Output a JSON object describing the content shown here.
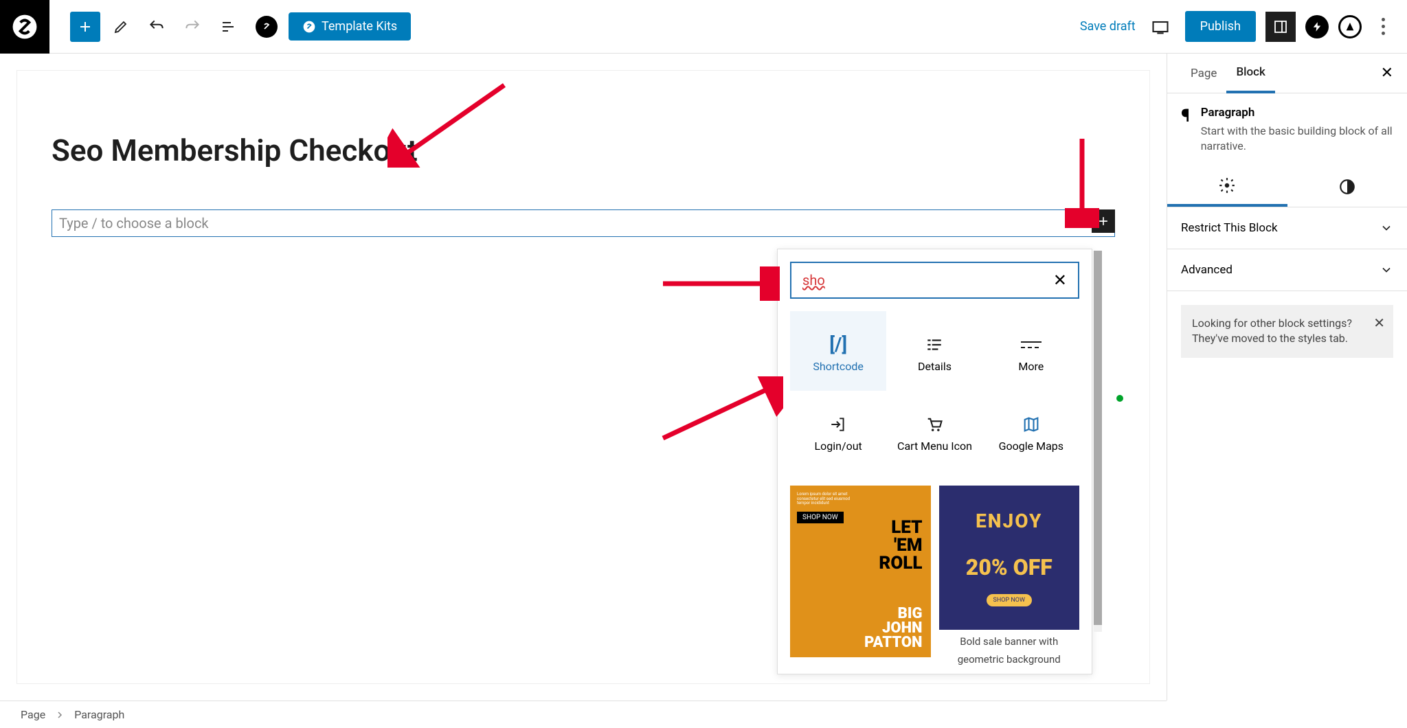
{
  "toolbar": {
    "template_kits": "Template Kits",
    "save_draft": "Save draft",
    "publish": "Publish"
  },
  "page": {
    "title": "Seo Membership Checkout",
    "block_placeholder": "Type / to choose a block"
  },
  "picker": {
    "search_value": "sho",
    "items": [
      {
        "label": "Shortcode"
      },
      {
        "label": "Details"
      },
      {
        "label": "More"
      },
      {
        "label": "Login/out"
      },
      {
        "label": "Cart Menu Icon"
      },
      {
        "label": "Google Maps"
      }
    ],
    "pattern1": {
      "line1": "LET",
      "line2": "'EM",
      "line3": "ROLL",
      "b1": "BIG",
      "b2": "JOHN",
      "b3": "PATTON",
      "shop": "SHOP NOW"
    },
    "pattern2": {
      "enjoy": "ENJOY",
      "percent": "20% OFF",
      "shop": "SHOP NOW",
      "caption1": "Bold sale banner with",
      "caption2": "geometric background"
    }
  },
  "sidebar": {
    "tabs": {
      "page": "Page",
      "block": "Block"
    },
    "block_name": "Paragraph",
    "block_desc": "Start with the basic building block of all narrative.",
    "panels": {
      "restrict": "Restrict This Block",
      "advanced": "Advanced"
    },
    "tip": "Looking for other block settings? They've moved to the styles tab."
  },
  "breadcrumb": {
    "page": "Page",
    "block": "Paragraph"
  }
}
